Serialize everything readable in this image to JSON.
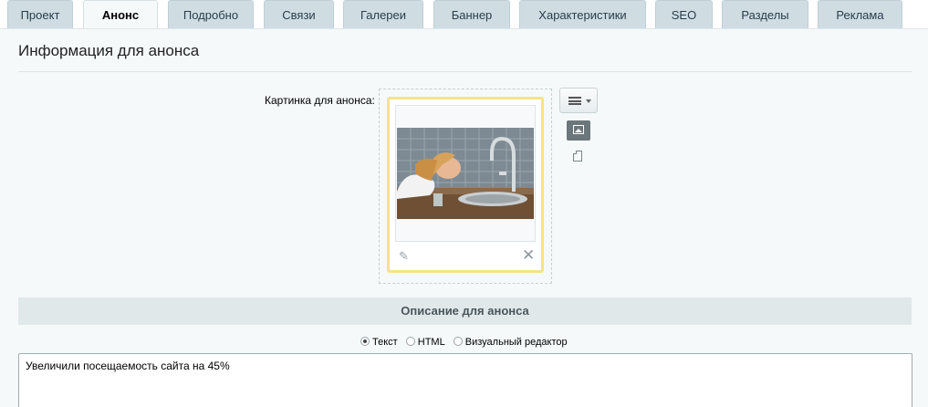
{
  "tabs": [
    {
      "label": "Проект"
    },
    {
      "label": "Анонс",
      "active": true
    },
    {
      "label": "Подробно"
    },
    {
      "label": "Связи"
    },
    {
      "label": "Галереи"
    },
    {
      "label": "Баннер"
    },
    {
      "label": "Характеристики"
    },
    {
      "label": "SEO"
    },
    {
      "label": "Разделы"
    },
    {
      "label": "Реклама"
    }
  ],
  "panel": {
    "title": "Информация для анонса",
    "picture_label": "Картинка для анонса:",
    "picture_icons": {
      "menu": "menu-icon",
      "image_mode": "image-icon",
      "file_mode": "file-icon",
      "edit": "pencil-icon",
      "remove": "close-icon"
    }
  },
  "description": {
    "header": "Описание для анонса",
    "modes": [
      {
        "label": "Текст",
        "checked": true
      },
      {
        "label": "HTML",
        "checked": false
      },
      {
        "label": "Визуальный редактор",
        "checked": false
      }
    ],
    "text": "Увеличили посещаемость сайта на 45%"
  },
  "colors": {
    "tab_bg": "#cfdde3",
    "panel_bg": "#f5f9f9",
    "section_header_bg": "#e0e8ea",
    "preview_border": "#f5e38a"
  }
}
